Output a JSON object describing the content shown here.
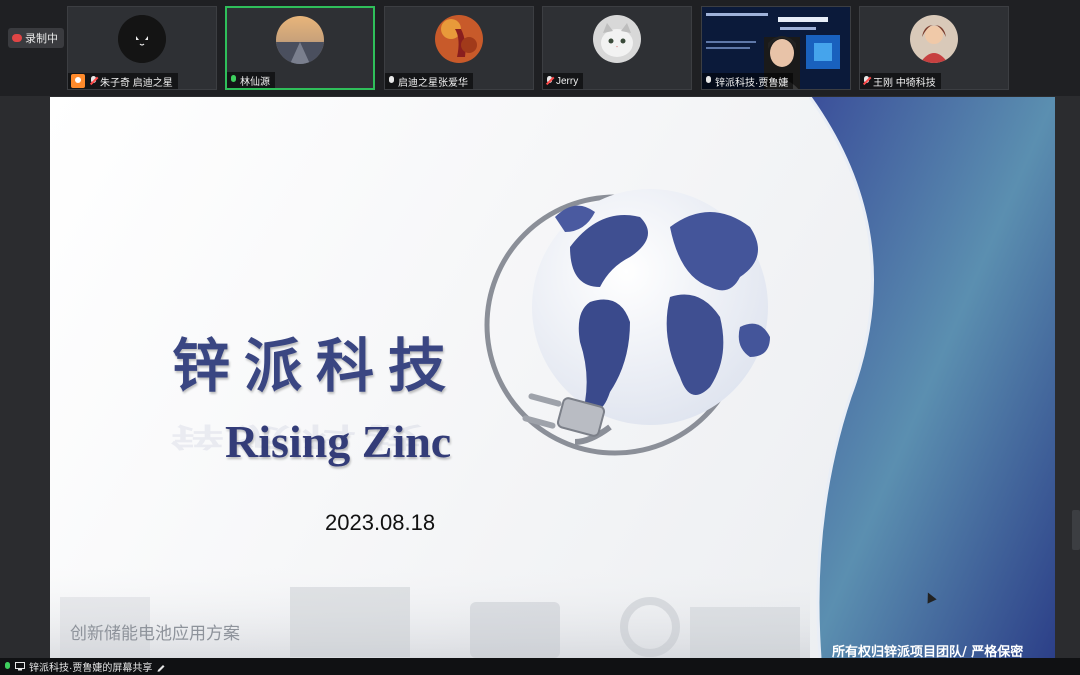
{
  "recording": {
    "label": "录制中"
  },
  "participants": [
    {
      "name": "朱子奇 启迪之星",
      "host": true,
      "mic": "off"
    },
    {
      "name": "林仙源",
      "active": true,
      "mic": "green"
    },
    {
      "name": "启迪之星张爱华",
      "mic": "on"
    },
    {
      "name": "Jerry",
      "mic": "off"
    },
    {
      "name": "锌派科技·贾鲁婕",
      "mic": "on"
    },
    {
      "name": "王刚 中犄科技",
      "mic": "off"
    }
  ],
  "slide": {
    "title_cn": "锌派科技",
    "title_en": "Rising Zinc",
    "date": "2023.08.18",
    "subtitle": "创新储能电池应用方案",
    "footer": "所有权归锌派项目团队/ 严格保密"
  },
  "status_bar": {
    "text": "锌派科技·贾鲁婕的屏幕共享"
  }
}
